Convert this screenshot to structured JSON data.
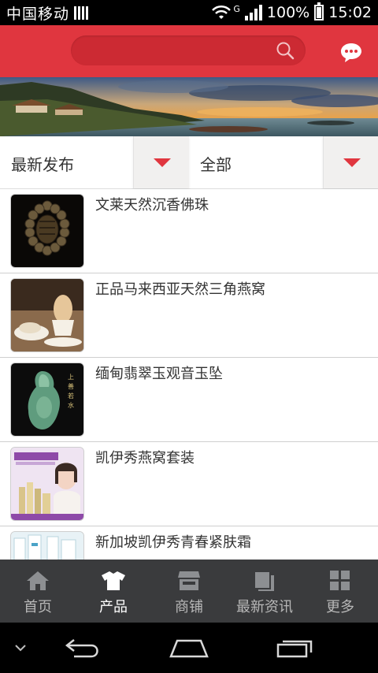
{
  "status_bar": {
    "carrier": "中国移动",
    "network_type": "G",
    "battery": "100%",
    "time": "15:02"
  },
  "header": {
    "search_icon": "search-icon",
    "chat_icon": "chat-bubble-icon",
    "accent_color": "#e0363f"
  },
  "filters": {
    "sort": {
      "label": "最新发布"
    },
    "category": {
      "label": "全部"
    }
  },
  "products": [
    {
      "title": "文莱天然沉香佛珠"
    },
    {
      "title": "正品马来西亚天然三角燕窝"
    },
    {
      "title": "缅甸翡翠玉观音玉坠"
    },
    {
      "title": "凯伊秀燕窝套装"
    },
    {
      "title": "新加坡凯伊秀青春紧肤霜"
    }
  ],
  "tabbar": {
    "tabs": [
      {
        "label": "首页",
        "icon": "home-icon",
        "active": false
      },
      {
        "label": "产品",
        "icon": "tshirt-icon",
        "active": true
      },
      {
        "label": "商铺",
        "icon": "store-icon",
        "active": false
      },
      {
        "label": "最新资讯",
        "icon": "news-icon",
        "active": false
      },
      {
        "label": "更多",
        "icon": "grid-icon",
        "active": false
      }
    ]
  },
  "nav_bar": {
    "icons": [
      "chevron-down-icon",
      "back-icon",
      "home-icon",
      "recent-apps-icon"
    ]
  }
}
